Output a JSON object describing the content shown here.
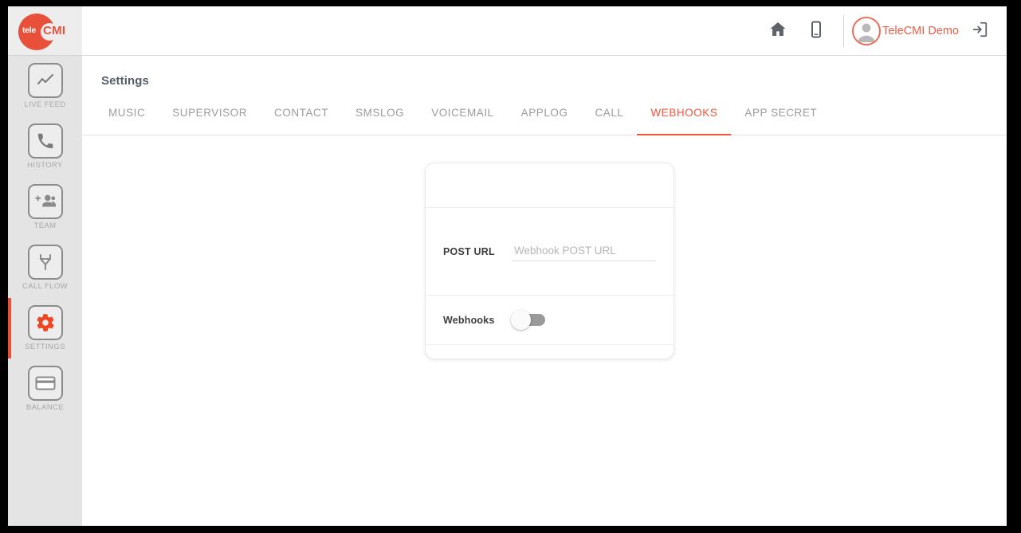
{
  "brand": {
    "logo_text_primary": "tele",
    "logo_text_secondary": "CMI",
    "accent_color": "#e8503a"
  },
  "sidebar": {
    "items": [
      {
        "label": "LIVE FEED",
        "icon": "line-chart-icon",
        "active": false
      },
      {
        "label": "HISTORY",
        "icon": "phone-icon",
        "active": false
      },
      {
        "label": "TEAM",
        "icon": "add-people-icon",
        "active": false
      },
      {
        "label": "CALL FLOW",
        "icon": "call-flow-icon",
        "active": false
      },
      {
        "label": "SETTINGS",
        "icon": "gear-icon",
        "active": true
      },
      {
        "label": "BALANCE",
        "icon": "card-icon",
        "active": false
      }
    ]
  },
  "header": {
    "home_icon": "home-icon",
    "mobile_icon": "mobile-icon",
    "user_name": "TeleCMI Demo",
    "avatar_icon": "avatar-icon",
    "logout_icon": "logout-icon",
    "user_name_color": "#ef5a45"
  },
  "main": {
    "page_title": "Settings",
    "tabs": [
      {
        "label": "MUSIC",
        "active": false
      },
      {
        "label": "SUPERVISOR",
        "active": false
      },
      {
        "label": "CONTACT",
        "active": false
      },
      {
        "label": "SMSLOG",
        "active": false
      },
      {
        "label": "VOICEMAIL",
        "active": false
      },
      {
        "label": "APPLOG",
        "active": false
      },
      {
        "label": "CALL",
        "active": false
      },
      {
        "label": "WEBHOOKS",
        "active": true
      },
      {
        "label": "APP SECRET",
        "active": false
      }
    ],
    "active_tab_color": "#f4543c"
  },
  "webhook_card": {
    "post_url_label": "POST URL",
    "post_url_value": "",
    "post_url_placeholder": "Webhook POST URL",
    "webhooks_label": "Webhooks",
    "webhooks_enabled": false
  }
}
